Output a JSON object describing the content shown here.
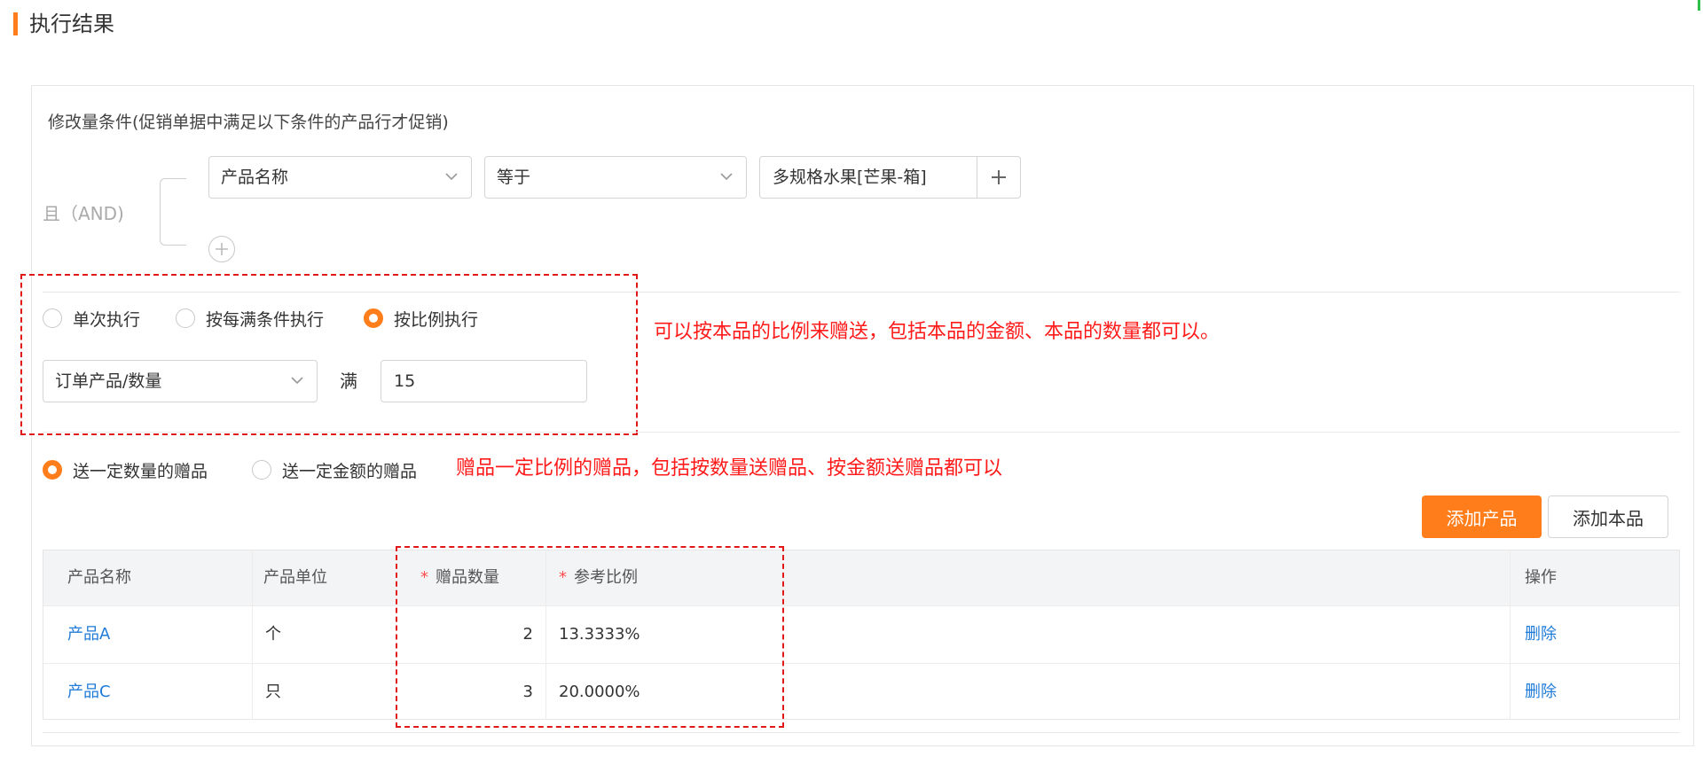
{
  "section": {
    "title": "执行结果"
  },
  "condition": {
    "heading": "修改量条件(促销单据中满足以下条件的产品行才促销)",
    "logic_label": "且（AND)",
    "field": "产品名称",
    "operator": "等于",
    "value": "多规格水果[芒果-箱]"
  },
  "execution": {
    "modes": [
      "单次执行",
      "按每满条件执行",
      "按比例执行"
    ],
    "selected_index": 2,
    "basis": "订单产品/数量",
    "threshold_label": "满",
    "threshold_value": "15"
  },
  "gift_type": {
    "options": [
      "送一定数量的赠品",
      "送一定金额的赠品"
    ],
    "selected_index": 0
  },
  "annotations": {
    "ratio_note": "可以按本品的比例来赠送，包括本品的金额、本品的数量都可以。",
    "gift_note": "赠品一定比例的赠品，包括按数量送赠品、按金额送赠品都可以"
  },
  "buttons": {
    "add_product": "添加产品",
    "add_self_product": "添加本品"
  },
  "table": {
    "columns": [
      "产品名称",
      "产品单位",
      "赠品数量",
      "参考比例",
      "操作"
    ],
    "required_mark": "*",
    "rows": [
      {
        "name": "产品A",
        "unit": "个",
        "qty": "2",
        "ratio": "13.3333%",
        "action": "删除"
      },
      {
        "name": "产品C",
        "unit": "只",
        "qty": "3",
        "ratio": "20.0000%",
        "action": "删除"
      }
    ]
  },
  "colors": {
    "accent": "#ff7d1a",
    "annotation": "#ff1a1a",
    "link": "#1f7bd8"
  },
  "icons": [
    "chevron-down-icon",
    "plus-icon",
    "add-circle-icon"
  ]
}
